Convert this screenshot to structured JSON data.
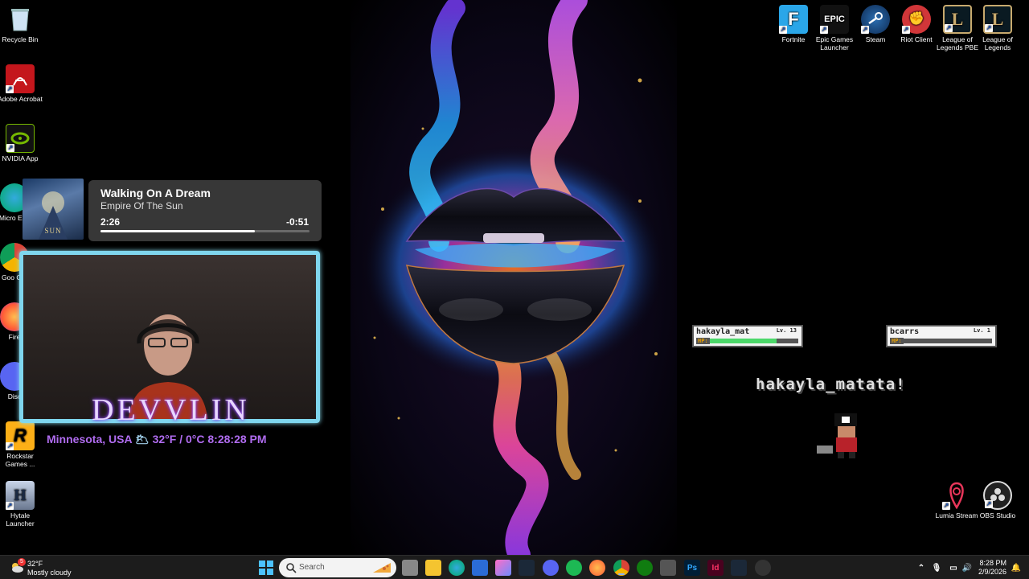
{
  "desktop_left": [
    {
      "label": "Recycle Bin",
      "icon": "recycle-bin-icon"
    },
    {
      "label": "Adobe Acrobat",
      "icon": "acrobat-icon"
    },
    {
      "label": "NVIDIA App",
      "icon": "nvidia-icon"
    },
    {
      "label": "Micro Edg",
      "icon": "edge-icon"
    },
    {
      "label": "Goo Chr",
      "icon": "chrome-icon"
    },
    {
      "label": "Fire",
      "icon": "firefox-icon"
    },
    {
      "label": "Disc",
      "icon": "discord-icon"
    },
    {
      "label": "Rockstar Games ...",
      "icon": "rockstar-icon"
    },
    {
      "label": "Hytale Launcher",
      "icon": "hytale-icon"
    }
  ],
  "desktop_right": [
    {
      "label": "Fortnite",
      "icon": "fortnite-icon"
    },
    {
      "label": "Epic Games Launcher",
      "icon": "epic-games-icon"
    },
    {
      "label": "Steam",
      "icon": "steam-icon"
    },
    {
      "label": "Riot Client",
      "icon": "riot-client-icon"
    },
    {
      "label": "League of Legends PBE",
      "icon": "league-pbe-icon"
    },
    {
      "label": "League of Legends",
      "icon": "league-icon"
    }
  ],
  "desktop_bottom_right": [
    {
      "label": "Lumia Stream",
      "icon": "lumia-stream-icon"
    },
    {
      "label": "OBS Studio",
      "icon": "obs-studio-icon"
    }
  ],
  "now_playing": {
    "title": "Walking On A Dream",
    "artist": "Empire Of The Sun",
    "elapsed": "2:26",
    "remaining": "-0:51",
    "progress": 0.74,
    "album_text": "SUN"
  },
  "webcam": {
    "name": "DEVVLIN",
    "location": "Minnesota, USA",
    "weather_icon": "🌥",
    "temperature": "32°F / 0°C",
    "time": "8:28:28 PM"
  },
  "overlay": {
    "player1": {
      "name": "hakayla_mat",
      "level": "Lv. 13",
      "hp_label": "HP:",
      "hp": 0.75
    },
    "player2": {
      "name": "bcarrs",
      "level": "Lv. 1",
      "hp_label": "HP:",
      "hp": 0.0
    },
    "message": "hakayla_matata!"
  },
  "taskbar": {
    "weather_temp": "32°F",
    "weather_cond": "Mostly cloudy",
    "weather_badge": "5",
    "search_placeholder": "Search",
    "time": "8:28 PM",
    "date": "2/9/2026",
    "accent": "#8ab4f8"
  }
}
